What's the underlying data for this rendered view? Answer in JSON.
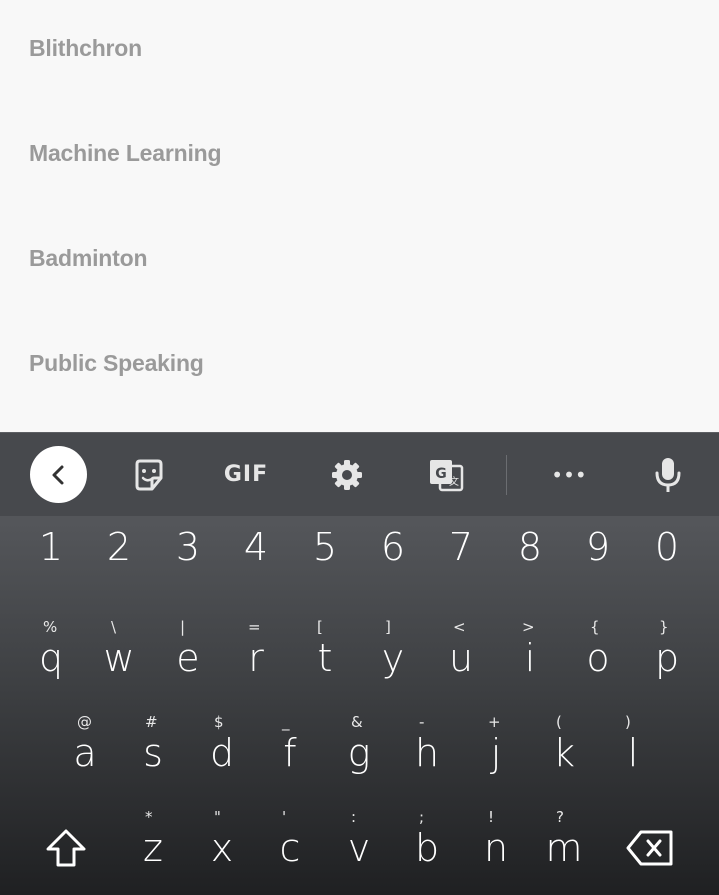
{
  "list": {
    "items": [
      "Blithchron",
      "Machine Learning",
      "Badminton",
      "Public Speaking"
    ]
  },
  "toolbar": {
    "gif_label": "GIF",
    "icons": [
      "back-icon",
      "sticker-icon",
      "gif-icon",
      "settings-icon",
      "translate-icon",
      "more-icon",
      "mic-icon"
    ],
    "more_label": "•••"
  },
  "keyboard": {
    "numbers": [
      "1",
      "2",
      "3",
      "4",
      "5",
      "6",
      "7",
      "8",
      "9",
      "0"
    ],
    "row1": [
      {
        "key": "q",
        "hint": "%"
      },
      {
        "key": "w",
        "hint": "\\"
      },
      {
        "key": "e",
        "hint": "|"
      },
      {
        "key": "r",
        "hint": "="
      },
      {
        "key": "t",
        "hint": "["
      },
      {
        "key": "y",
        "hint": "]"
      },
      {
        "key": "u",
        "hint": "<"
      },
      {
        "key": "i",
        "hint": ">"
      },
      {
        "key": "o",
        "hint": "{"
      },
      {
        "key": "p",
        "hint": "}"
      }
    ],
    "row2": [
      {
        "key": "a",
        "hint": "@"
      },
      {
        "key": "s",
        "hint": "#"
      },
      {
        "key": "d",
        "hint": "$"
      },
      {
        "key": "f",
        "hint": "_"
      },
      {
        "key": "g",
        "hint": "&"
      },
      {
        "key": "h",
        "hint": "-"
      },
      {
        "key": "j",
        "hint": "+"
      },
      {
        "key": "k",
        "hint": "("
      },
      {
        "key": "l",
        "hint": ")"
      }
    ],
    "row3": [
      {
        "key": "z",
        "hint": "*"
      },
      {
        "key": "x",
        "hint": "\""
      },
      {
        "key": "c",
        "hint": "'"
      },
      {
        "key": "v",
        "hint": ":"
      },
      {
        "key": "b",
        "hint": ";"
      },
      {
        "key": "n",
        "hint": "!"
      },
      {
        "key": "m",
        "hint": "?"
      }
    ]
  },
  "colors": {
    "list_bg": "#f8f8f8",
    "list_text": "#9a9a9a",
    "keyboard_bg": "#2b2c2f",
    "toolbar_bg": "#47494d"
  }
}
